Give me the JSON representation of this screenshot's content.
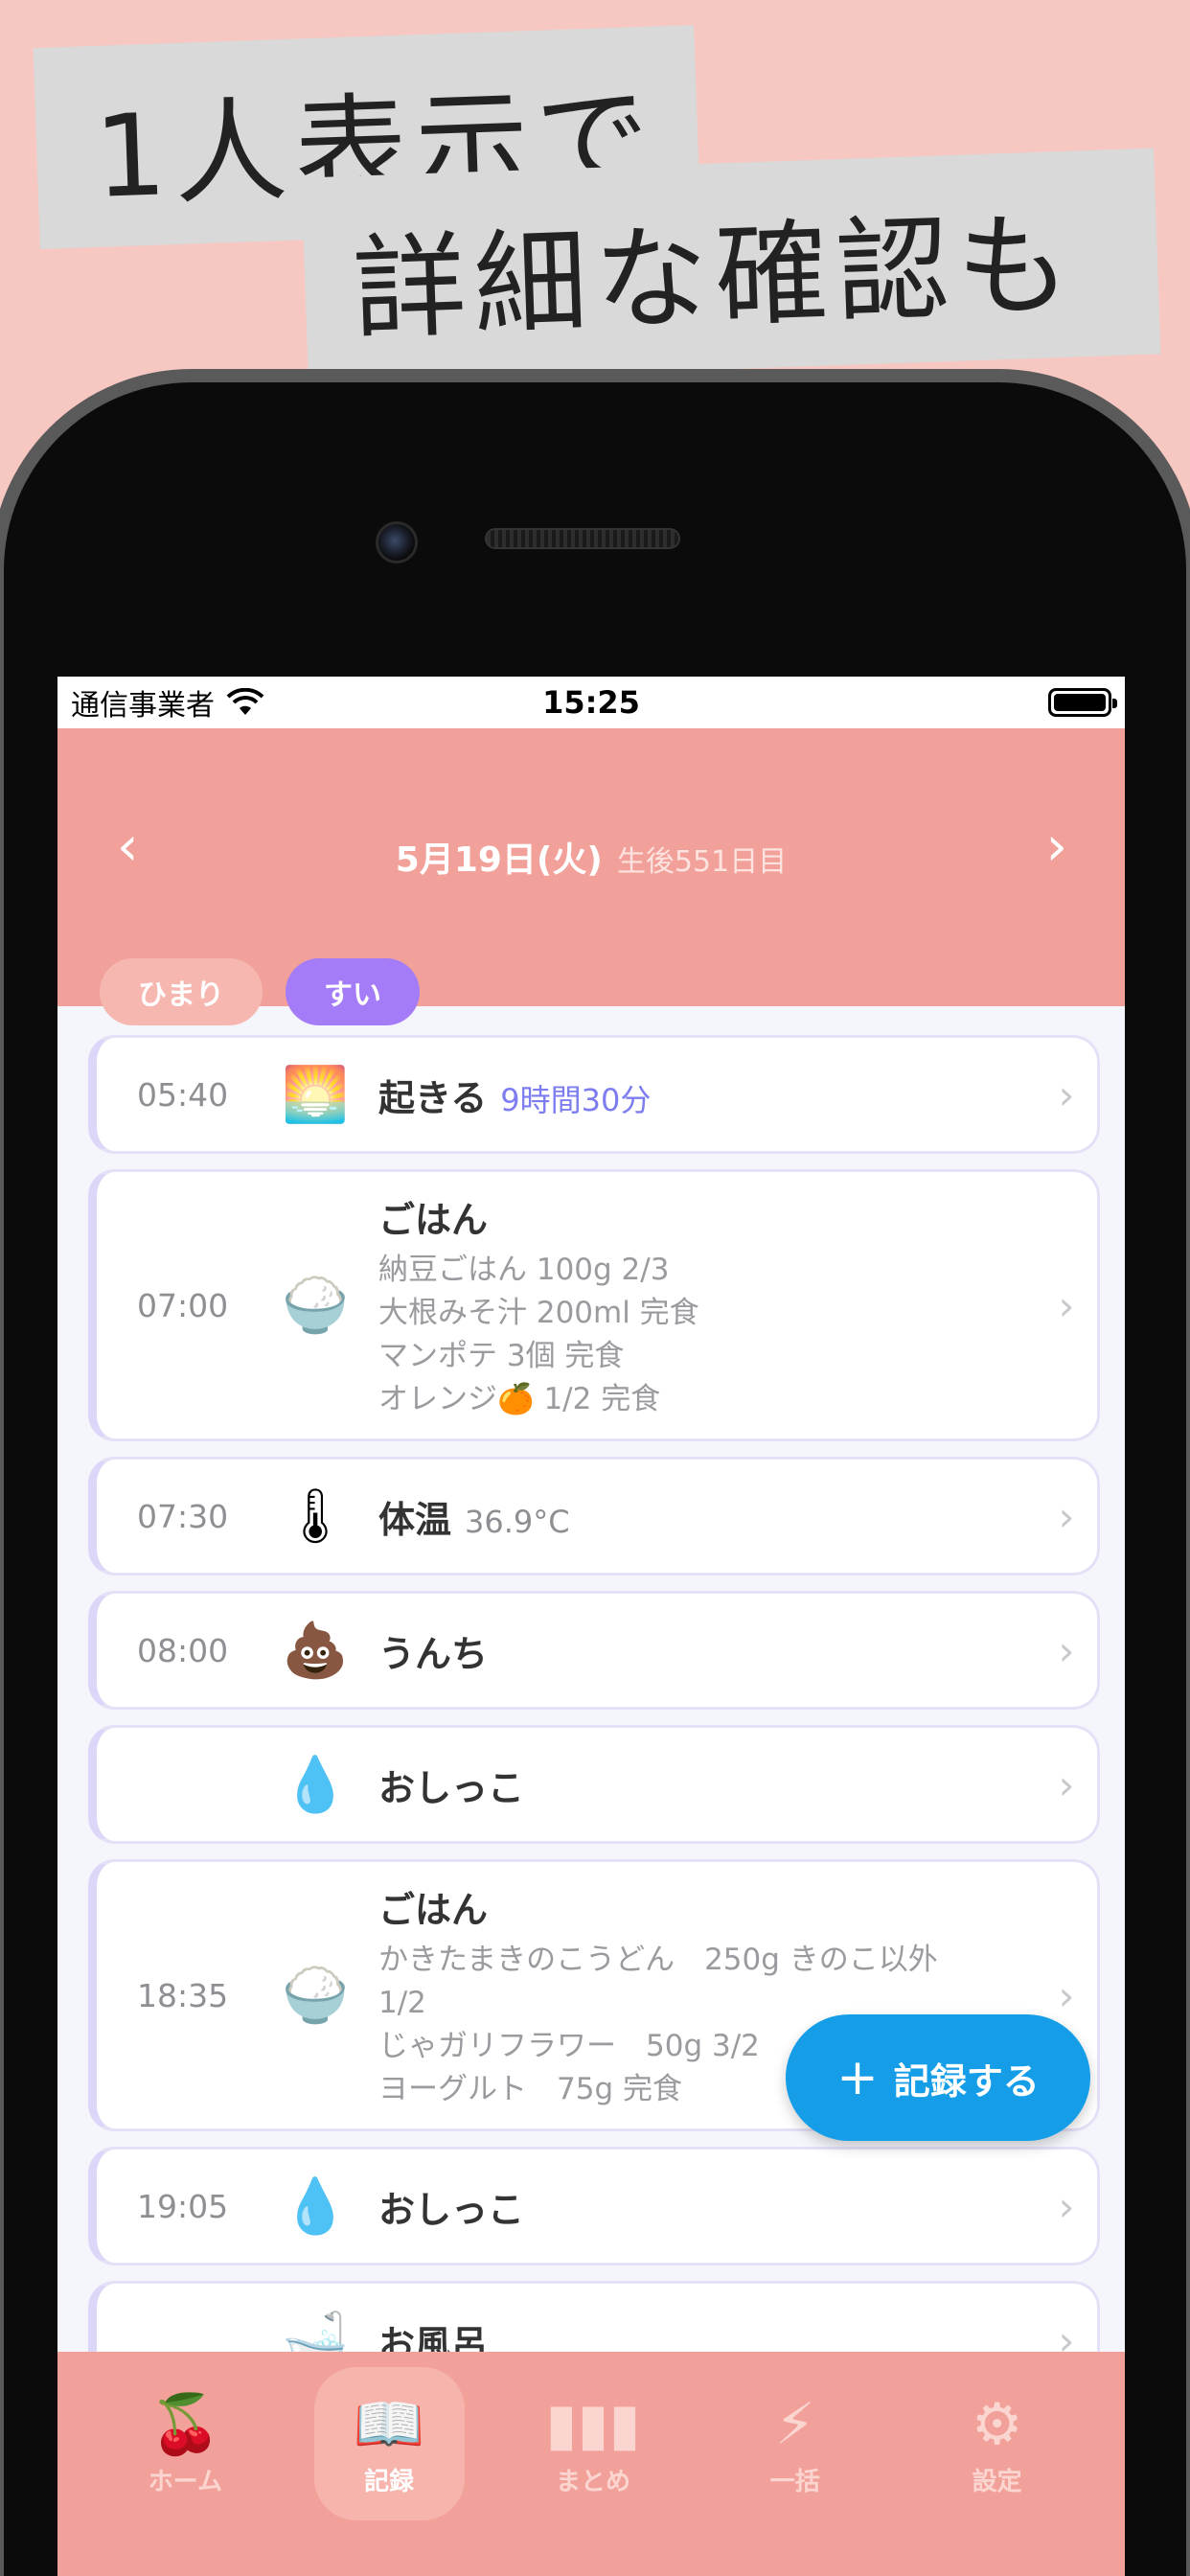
{
  "headline": {
    "line1": "1人表示で",
    "line2": "詳細な確認も"
  },
  "statusbar": {
    "carrier": "通信事業者",
    "time": "15:25"
  },
  "header": {
    "prev": "‹",
    "next": "›",
    "date": "5月19日(火)",
    "age": "生後551日目"
  },
  "chips": [
    {
      "label": "ひまり",
      "active": false
    },
    {
      "label": "すい",
      "active": true
    }
  ],
  "records": [
    {
      "time": "05:40",
      "icon": "sunrise-icon",
      "glyph": "🌅",
      "title": "起きる",
      "sub": "9時間30分",
      "details": []
    },
    {
      "time": "07:00",
      "icon": "rice-icon",
      "glyph": "🍚",
      "title": "ごはん",
      "sub": "",
      "details": [
        "納豆ごはん 100g 2/3",
        "大根みそ汁 200ml 完食",
        "マンポテ 3個 完食",
        "オレンジ🍊 1/2 完食"
      ]
    },
    {
      "time": "07:30",
      "icon": "thermometer-icon",
      "glyph": "🌡",
      "title": "体温",
      "sub": "36.9°C",
      "details": []
    },
    {
      "time": "08:00",
      "icon": "poop-icon",
      "glyph": "💩",
      "title": "うんち",
      "sub": "",
      "details": []
    },
    {
      "time": "",
      "icon": "droplet-icon",
      "glyph": "💧",
      "title": "おしっこ",
      "sub": "",
      "details": []
    },
    {
      "time": "18:35",
      "icon": "rice-icon",
      "glyph": "🍚",
      "title": "ごはん",
      "sub": "",
      "details": [
        "かきたまきのこうどん　250g きのこ以外",
        "1/2",
        "じゃガリフラワー　50g 3/2",
        "ヨーグルト　75g 完食"
      ]
    },
    {
      "time": "19:05",
      "icon": "droplet-icon",
      "glyph": "💧",
      "title": "おしっこ",
      "sub": "",
      "details": []
    },
    {
      "time": "",
      "icon": "bathtub-icon",
      "glyph": "🛁",
      "title": "お風呂",
      "sub": "",
      "details": []
    }
  ],
  "fab": {
    "plus": "+",
    "label": "記録する"
  },
  "tabs": [
    {
      "label": "ホーム",
      "icon": "cherry-icon",
      "glyph": "🍒",
      "active": false
    },
    {
      "label": "記録",
      "icon": "book-icon",
      "glyph": "📖",
      "active": true
    },
    {
      "label": "まとめ",
      "icon": "bar-chart-icon",
      "glyph": "▮▮▮",
      "active": false
    },
    {
      "label": "一括",
      "icon": "lightning-icon",
      "glyph": "⚡",
      "active": false
    },
    {
      "label": "設定",
      "icon": "gear-icon",
      "glyph": "⚙",
      "active": false
    }
  ]
}
